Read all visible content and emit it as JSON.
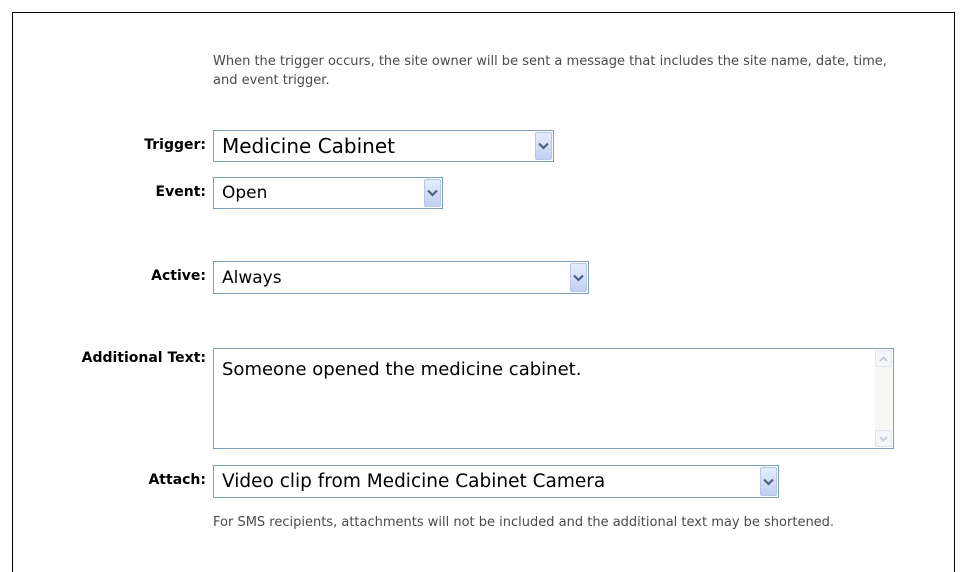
{
  "description": "When the trigger occurs, the site owner will be sent a message that includes the site name, date, time, and event trigger.",
  "trigger": {
    "label": "Trigger:",
    "value": "Medicine Cabinet"
  },
  "event": {
    "label": "Event:",
    "value": "Open"
  },
  "active": {
    "label": "Active:",
    "value": "Always"
  },
  "additional_text": {
    "label": "Additional Text:",
    "value": "Someone opened the medicine cabinet."
  },
  "attach": {
    "label": "Attach:",
    "value": "Video clip from Medicine Cabinet Camera"
  },
  "sms_note": "For SMS recipients, attachments will not be included and the additional text may be shortened.",
  "icons": {
    "dropdown": "chevron-down-icon",
    "scroll_up": "scroll-up-icon",
    "scroll_down": "scroll-down-icon"
  },
  "colors": {
    "border": "#7f9db9",
    "button": "#bfd0f1",
    "arrow": "#4d6185",
    "help_text": "#4a4a4a"
  }
}
